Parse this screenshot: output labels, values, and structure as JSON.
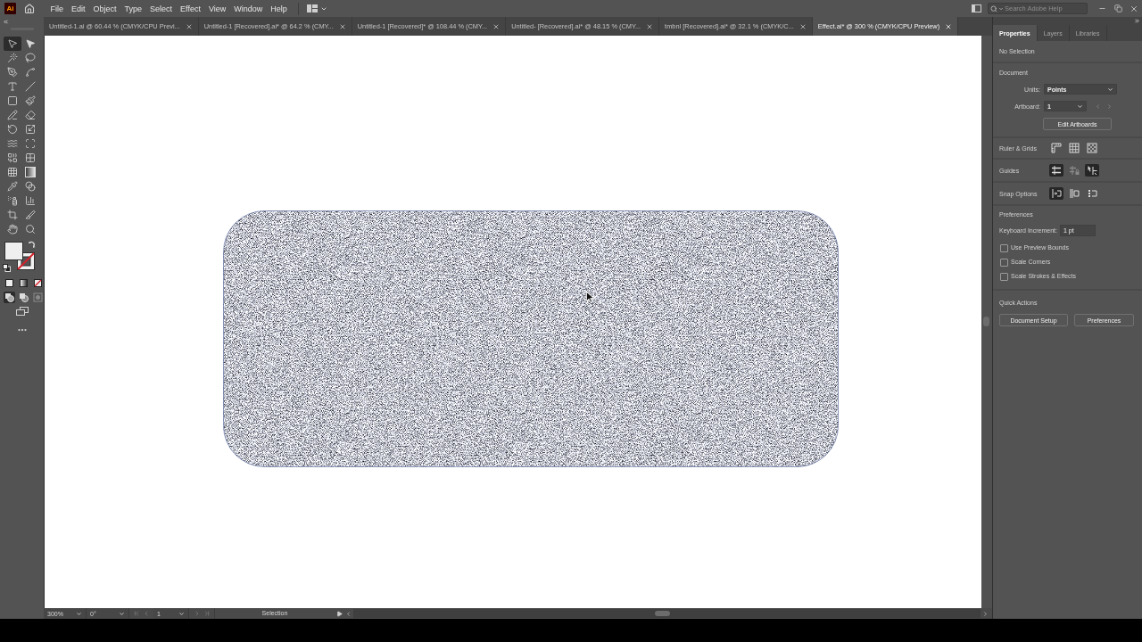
{
  "app_bar": {
    "logo": "Ai",
    "menu": [
      "File",
      "Edit",
      "Object",
      "Type",
      "Select",
      "Effect",
      "View",
      "Window",
      "Help"
    ],
    "search": {
      "placeholder": "Search Adobe Help"
    }
  },
  "document_tabs": [
    {
      "label": "Untitled-1.ai @ 60.44 % (CMYK/CPU Previ...",
      "selected": false
    },
    {
      "label": "Untitled-1 [Recovered].ai* @ 64.2 % (CMY...",
      "selected": false
    },
    {
      "label": "Untitled-1 [Recovered]* @ 108.44 % (CMY...",
      "selected": false
    },
    {
      "label": "Untitled- [Recovered].ai* @ 48.15 % (CMY...",
      "selected": false
    },
    {
      "label": "tmbnl [Recovered].ai* @ 32.1 % (CMYK/C...",
      "selected": false
    },
    {
      "label": "Effect.ai* @ 300 % (CMYK/CPU Preview)",
      "selected": true
    }
  ],
  "toolbar": {
    "tools": [
      {
        "kind": "selection",
        "selected": true
      },
      {
        "kind": "direct-selection",
        "selected": false
      },
      {
        "kind": "magic-wand",
        "selected": false
      },
      {
        "kind": "lasso",
        "selected": false
      },
      {
        "kind": "pen",
        "selected": false
      },
      {
        "kind": "curvature",
        "selected": false
      },
      {
        "kind": "type",
        "selected": false
      },
      {
        "kind": "line",
        "selected": false
      },
      {
        "kind": "rectangle",
        "selected": false
      },
      {
        "kind": "paintbrush",
        "selected": false
      },
      {
        "kind": "shaper",
        "selected": false
      },
      {
        "kind": "eraser",
        "selected": false
      },
      {
        "kind": "rotate",
        "selected": false
      },
      {
        "kind": "scale",
        "selected": false
      },
      {
        "kind": "warp",
        "selected": false
      },
      {
        "kind": "free-transform",
        "selected": false
      },
      {
        "kind": "shape-builder",
        "selected": false
      },
      {
        "kind": "perspective",
        "selected": false
      },
      {
        "kind": "mesh",
        "selected": false
      },
      {
        "kind": "gradient",
        "selected": false
      },
      {
        "kind": "eyedropper",
        "selected": false
      },
      {
        "kind": "blend",
        "selected": false
      },
      {
        "kind": "sprayer",
        "selected": false
      },
      {
        "kind": "graph",
        "selected": false
      },
      {
        "kind": "artboard",
        "selected": false
      },
      {
        "kind": "slice",
        "selected": false
      },
      {
        "kind": "hand",
        "selected": false
      },
      {
        "kind": "zoom",
        "selected": false
      }
    ],
    "draw_modes": [
      {
        "kind": "normal",
        "selected": true,
        "disabled": false
      },
      {
        "kind": "behind",
        "selected": false,
        "disabled": false
      },
      {
        "kind": "inside",
        "selected": false,
        "disabled": true
      }
    ]
  },
  "properties_panel": {
    "tabs": [
      {
        "label": "Properties",
        "selected": true
      },
      {
        "label": "Layers",
        "selected": false
      },
      {
        "label": "Libraries",
        "selected": false
      }
    ],
    "selection_status": "No Selection",
    "document": {
      "heading": "Document",
      "units": {
        "label": "Units:",
        "value": "Points"
      },
      "artboard": {
        "label": "Artboard:",
        "value": "1",
        "navigation_disabled": true
      },
      "edit_button": "Edit Artboards"
    },
    "ruler_grids": {
      "label": "Ruler & Grids",
      "buttons": [
        {
          "kind": "rulers",
          "on": false
        },
        {
          "kind": "grid",
          "on": false
        },
        {
          "kind": "transparency",
          "on": false
        }
      ]
    },
    "guides": {
      "label": "Guides",
      "buttons": [
        {
          "kind": "guides",
          "on": true,
          "disabled": false
        },
        {
          "kind": "lock",
          "on": false,
          "disabled": true
        },
        {
          "kind": "smart",
          "on": true,
          "disabled": false
        }
      ]
    },
    "snap_options": {
      "label": "Snap Options",
      "buttons": [
        {
          "kind": "point",
          "on": true
        },
        {
          "kind": "snap-grid",
          "on": false
        },
        {
          "kind": "pixel",
          "on": false
        }
      ]
    },
    "preferences": {
      "heading": "Preferences",
      "keyboard_increment": {
        "label": "Keyboard Increment:",
        "value": "1 pt"
      },
      "checkboxes": [
        {
          "label": "Use Preview Bounds",
          "checked": false
        },
        {
          "label": "Scale Corners",
          "checked": false
        },
        {
          "label": "Scale Strokes & Effects",
          "checked": false
        }
      ]
    },
    "quick_actions": {
      "heading": "Quick Actions",
      "buttons": [
        "Document Setup",
        "Preferences"
      ]
    }
  },
  "status_bar": {
    "zoom": "300%",
    "rotation": "0°",
    "artboard": "1",
    "navigation_disabled": true,
    "tool": "Selection"
  }
}
